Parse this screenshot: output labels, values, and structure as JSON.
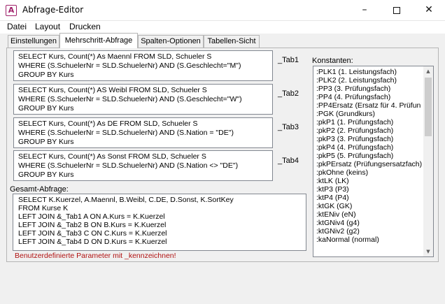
{
  "window": {
    "title": "Abfrage-Editor",
    "icon": "A",
    "controls": {
      "minimize": "–",
      "close": "✕"
    }
  },
  "menu": [
    "Datei",
    "Layout",
    "Drucken"
  ],
  "tabs": [
    "Einstellungen",
    "Mehrschritt-Abfrage",
    "Spalten-Optionen",
    "Tabellen-Sicht"
  ],
  "active_tab": "Mehrschritt-Abfrage",
  "queries": [
    {
      "name": "_Tab1",
      "sql": "SELECT Kurs, Count(*) As Maennl FROM SLD, Schueler S\nWHERE (S.SchuelerNr = SLD.SchuelerNr) AND (S.Geschlecht=\"M\")\nGROUP BY Kurs"
    },
    {
      "name": "_Tab2",
      "sql": "SELECT Kurs, Count(*) AS Weibl FROM SLD, Schueler S\nWHERE (S.SchuelerNr = SLD.SchuelerNr) AND (S.Geschlecht=\"W\")\nGROUP BY Kurs"
    },
    {
      "name": "_Tab3",
      "sql": "SELECT Kurs, Count(*) As DE FROM SLD, Schueler S\nWHERE (S.SchuelerNr = SLD.SchuelerNr) AND (S.Nation = \"DE\")\nGROUP BY Kurs"
    },
    {
      "name": "_Tab4",
      "sql": "SELECT Kurs, Count(*) As Sonst FROM SLD, Schueler S\nWHERE (S.SchuelerNr = SLD.SchuelerNr) AND (S.Nation <> \"DE\")\nGROUP BY Kurs"
    }
  ],
  "konstanten": {
    "label": "Konstanten:",
    "items": [
      ":PLK1 (1. Leistungsfach)",
      ":PLK2 (2. Leistungsfach)",
      ":PP3 (3. Prüfungsfach)",
      ":PP4 (4. Prüfungsfach)",
      ":PP4Ersatz (Ersatz für 4. Prüfun",
      ":PGK (Grundkurs)",
      ":pkP1 (1. Prüfungsfach)",
      ":pkP2 (2. Prüfungsfach)",
      ":pkP3 (3. Prüfungsfach)",
      ":pkP4 (4. Prüfungsfach)",
      ":pkP5 (5. Prüfungsfach)",
      ":pkPErsatz (Prüfungsersatzfach)",
      ":pkOhne (keins)",
      ":ktLK (LK)",
      ":ktP3 (P3)",
      ":ktP4 (P4)",
      ":ktGK (GK)",
      ":ktENiv (eN)",
      ":ktGNiv4 (g4)",
      ":ktGNiv2 (g2)",
      ":kaNormal (normal)"
    ]
  },
  "gesamt": {
    "label": "Gesamt-Abfrage:",
    "sql": "SELECT K.Kuerzel, A.Maennl, B.Weibl, C.DE, D.Sonst, K.SortKey\nFROM Kurse K\nLEFT JOIN &_Tab1 A ON A.Kurs = K.Kuerzel\nLEFT JOIN &_Tab2 B ON B.Kurs = K.Kuerzel\nLEFT JOIN &_Tab3 C ON C.Kurs = K.Kuerzel\nLEFT JOIN &_Tab4 D ON D.Kurs = K.Kuerzel",
    "hint": "Benutzerdefinierte Parameter mit _kennzeichnen!"
  },
  "colors": {
    "accent": "#a0206a",
    "hint": "#b01010"
  },
  "icons": {
    "app": "app-a-icon",
    "minimize": "minimize-icon",
    "maximize": "maximize-icon",
    "close": "close-icon",
    "scroll_up": "chevron-up-icon",
    "scroll_down": "chevron-down-icon"
  }
}
